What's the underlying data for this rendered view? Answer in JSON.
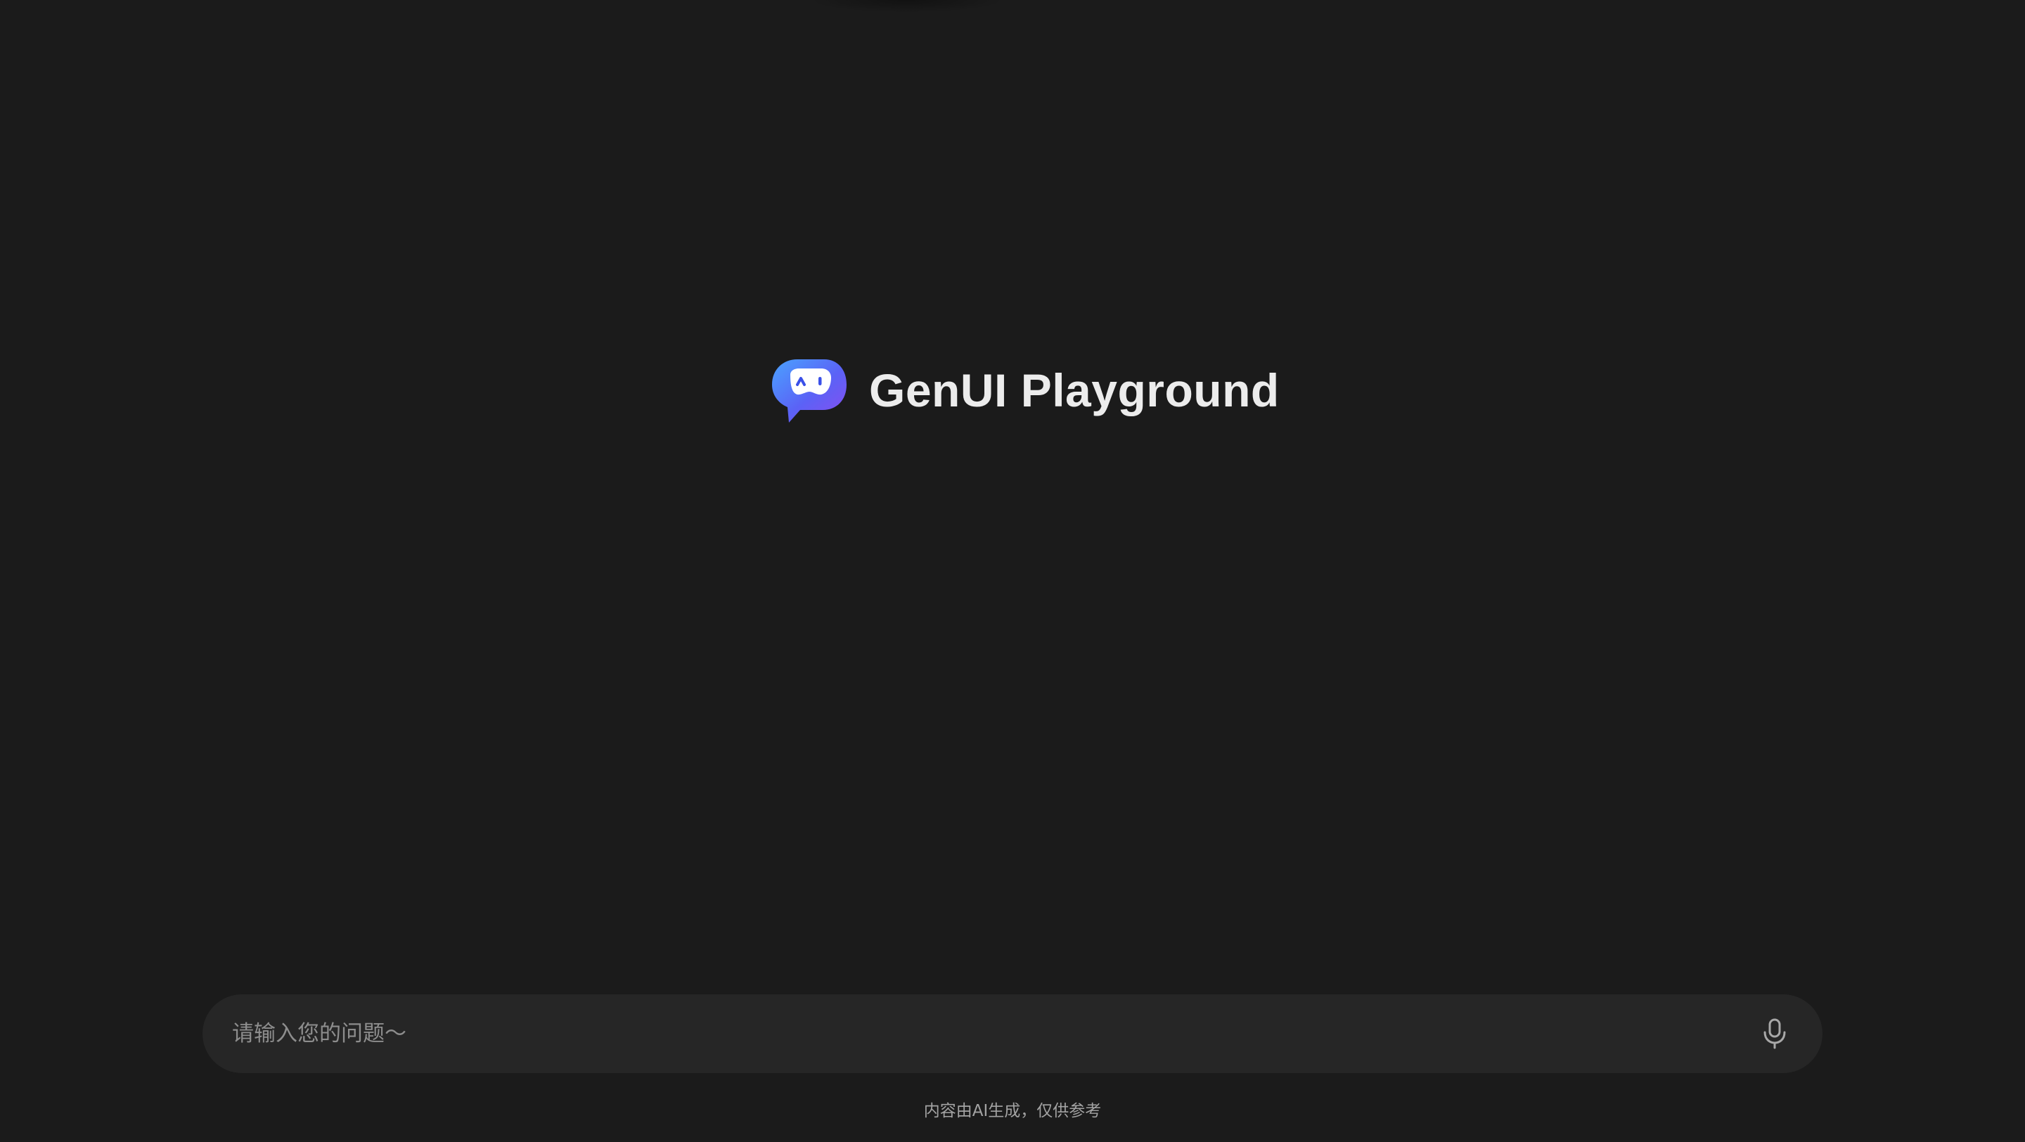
{
  "brand": {
    "title": "GenUI Playground",
    "logo_icon": "robot-chat-bubble-icon",
    "logo_colors": [
      "#4aa3ff",
      "#5b54f5",
      "#8a4df0"
    ]
  },
  "chat_input": {
    "placeholder": "请输入您的问题～",
    "value": "",
    "mic_icon": "microphone-icon"
  },
  "footer": {
    "disclaimer": "内容由AI生成，仅供参考"
  },
  "theme": {
    "background": "#1b1b1b",
    "input_background": "#262626"
  }
}
